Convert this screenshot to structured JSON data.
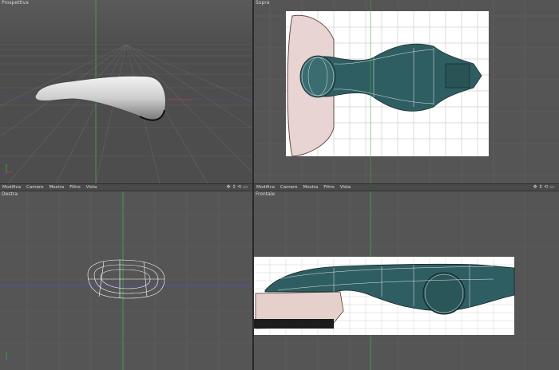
{
  "viewports": {
    "top_left": {
      "title": "Prospettiva"
    },
    "top_right": {
      "title": "Sopra"
    },
    "bottom_left": {
      "title": "Destra"
    },
    "bottom_right": {
      "title": "Frontale"
    }
  },
  "menus": {
    "left": [
      "Modifica",
      "Camere",
      "Mostra",
      "Filtro",
      "Vista"
    ],
    "right": [
      "Modifica",
      "Camere",
      "Mostra",
      "Filtro",
      "Vista"
    ]
  },
  "nav_icons": "✥ ⇕ ⟲ ▭",
  "colors": {
    "viewport_bg": "#555555",
    "grid_line": "#666666",
    "axis_green": "#3fae3f",
    "axis_blue": "#4a4fd8",
    "axis_red": "#c43a3a",
    "model_teal": "#2f5e62",
    "wire": "#ffffff"
  }
}
